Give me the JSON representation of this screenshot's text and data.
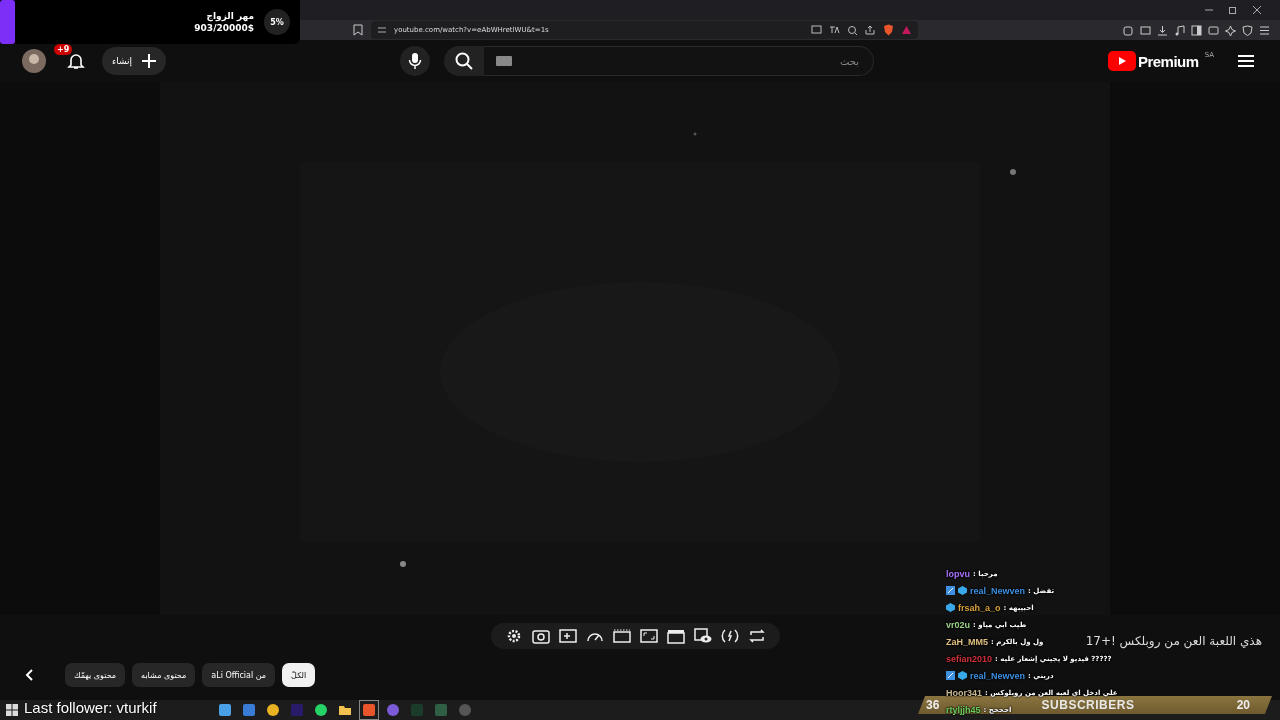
{
  "browser": {
    "url": "youtube.com/watch?v=eAbWHretlWU&t=1s"
  },
  "goal_overlay": {
    "title": "مهر الزواج",
    "amount": "903/20000$",
    "percent": "5%",
    "level": 0.05
  },
  "header": {
    "create_label": "إنشاء",
    "notification_count": "+9",
    "search_placeholder": "بحث",
    "logo_text": "Premium",
    "region": "SA"
  },
  "chips": [
    {
      "label": "الكلّ",
      "selected": true
    },
    {
      "label": "من aLi Official",
      "selected": false
    },
    {
      "label": "محتوى مشابه",
      "selected": false
    },
    {
      "label": "محتوى يهمّك",
      "selected": false
    }
  ],
  "chat": [
    {
      "user": "lopvu",
      "message": ": مرحبا",
      "color": "#a970ff",
      "kind": "plain"
    },
    {
      "user": "real_Newven",
      "message": ": تفضل",
      "color": "#3d8fe0",
      "kind": "moderator"
    },
    {
      "user": "frsah_a_o",
      "message": ": احبيبهه",
      "color": "#d9a23a",
      "kind": "subscriber"
    },
    {
      "user": "vr02u",
      "message": ": طيب ابي مياو",
      "color": "#9ad28a",
      "kind": "plain"
    },
    {
      "user": "ZaH_MM5",
      "message": ": ول ول بالكرم",
      "color": "#e0c080",
      "kind": "plain"
    },
    {
      "user": "sefian2010",
      "message": ": فيديو لا يجيني إشعار عليه ?????",
      "color": "#d0303a",
      "kind": "plain"
    },
    {
      "user": "real_Newven",
      "message": ": دربني",
      "color": "#3d8fe0",
      "kind": "moderator"
    },
    {
      "user": "Hoor341",
      "message": ": علي ادخل اي لعبه العن من روبلوكس",
      "color": "#c8b890",
      "kind": "plain"
    },
    {
      "user": "rtyljjh45",
      "message": ": احححح",
      "color": "#6ccf5a",
      "kind": "plain"
    }
  ],
  "video_card_title": "هذي اللعبة العن من روبلكس !+17",
  "subscribers_bar": {
    "left_count": "36",
    "label": "SUBSCRIBERS",
    "right_count": "20"
  },
  "last_follower": "Last follower: vturkif"
}
